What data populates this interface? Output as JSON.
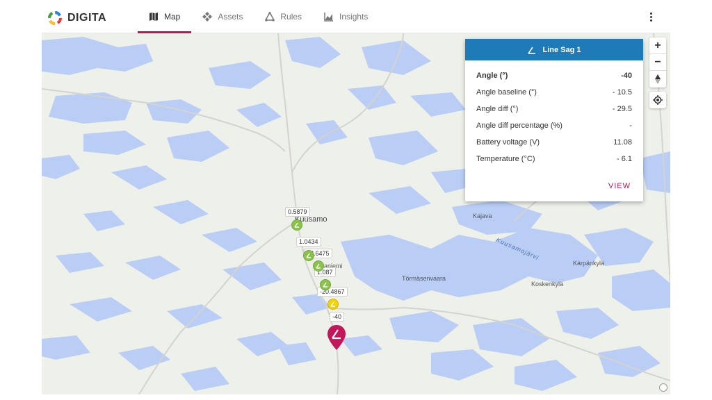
{
  "app": {
    "brand": "DIGITA"
  },
  "nav": {
    "tabs": [
      {
        "label": "Map",
        "icon": "map-icon",
        "active": true
      },
      {
        "label": "Assets",
        "icon": "assets-icon",
        "active": false
      },
      {
        "label": "Rules",
        "icon": "rules-icon",
        "active": false
      },
      {
        "label": "Insights",
        "icon": "insights-icon",
        "active": false
      }
    ]
  },
  "map": {
    "places": {
      "kuusamo": "Kuusamo",
      "ruka": "Rukaniemi",
      "tormasenvaara": "Törmäsenvaara",
      "kajava": "Kajava",
      "kuusamojarvi": "Kuusamojärvi",
      "karpankyla": "Kärpänkylä",
      "koskenkyla": "Koskenkylä"
    },
    "sensor_values": [
      "0.5879",
      "1.0434",
      "17.6475",
      "1.087",
      "-20.4867",
      "-40"
    ],
    "colors": {
      "green": "#8bc34a",
      "yellow": "#f4d20a",
      "magenta": "#c2185b",
      "water": "#b9cdf5",
      "land": "#eef0ea"
    },
    "zoom_in": "+",
    "zoom_out": "−"
  },
  "popup": {
    "title": "Line Sag 1",
    "header_color": "#1f7ab8",
    "rows": [
      {
        "label": "Angle (°)",
        "value": "-40"
      },
      {
        "label": "Angle baseline (°)",
        "value": "- 10.5"
      },
      {
        "label": "Angle diff (°)",
        "value": "- 29.5"
      },
      {
        "label": "Angle diff percentage (%)",
        "value": "-"
      },
      {
        "label": "Battery voltage (V)",
        "value": "11.08"
      },
      {
        "label": "Temperature (°C)",
        "value": "- 6.1"
      }
    ],
    "view_label": "VIEW"
  }
}
